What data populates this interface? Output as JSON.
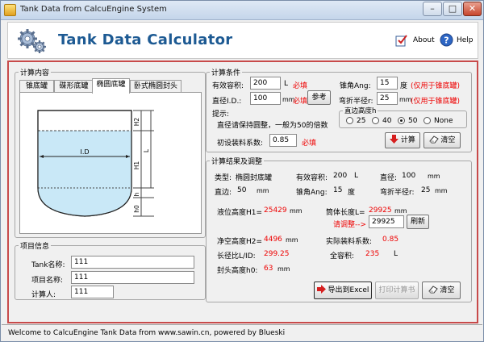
{
  "window": {
    "title": "Tank Data from CalcuEngine System"
  },
  "header": {
    "app_title": "Tank Data Calculator",
    "about": "About",
    "help": "Help"
  },
  "left": {
    "section_title": "计算内容",
    "tabs": [
      "锥底罐",
      "碟形底罐",
      "椭圆底罐",
      "卧式椭圆封头"
    ],
    "selected_tab": 2,
    "diagram": {
      "dim_labels": [
        "H2",
        "L",
        "H1",
        "I.D",
        "h",
        "h0"
      ]
    },
    "info": {
      "title": "项目信息",
      "tank_name_label": "Tank名称:",
      "tank_name": "111",
      "project_name_label": "项目名称:",
      "project_name": "111",
      "calc_person_label": "计算人:",
      "calc_person": "111"
    }
  },
  "conditions": {
    "title": "计算条件",
    "volume_label": "有效容积:",
    "volume": "200",
    "volume_unit": "L",
    "required": "必填",
    "id_label": "直径I.D.:",
    "id": "100",
    "id_unit": "mm",
    "ref_button": "参考",
    "tip_label": "提示:",
    "tip_text": "直径请保持圆整，一般为50的倍数",
    "fill_label": "初设装料系数:",
    "fill": "0.85",
    "cone_label": "锥角Ang:",
    "cone": "15",
    "cone_unit": "度",
    "cone_note": "(仅用于锥底罐)",
    "bend_label": "弯折半径r:",
    "bend": "25",
    "bend_unit": "mm",
    "bend_note": "(仅用于锥底罐)",
    "straight_title": "直边高度h",
    "straight_options": [
      "25",
      "40",
      "50",
      "None"
    ],
    "straight_selected": 2,
    "calc_button": "计算",
    "clear_button": "清空"
  },
  "results": {
    "title": "计算结果及调整",
    "type_label": "类型:",
    "type": "椭圆封底罐",
    "vol_label": "有效容积:",
    "vol": "200",
    "vol_unit": "L",
    "dia_label": "直径:",
    "dia": "100",
    "dia_unit": "mm",
    "h_label": "直边:",
    "h": "50",
    "h_unit": "mm",
    "ang_label": "锥角Ang:",
    "ang": "15",
    "ang_unit": "度",
    "r_label": "弯折半径r:",
    "r": "25",
    "r_unit": "mm",
    "h1_label": "液位高度H1=",
    "h1": "25429",
    "h1_unit": "mm",
    "l_label": "筒体长度L=",
    "l": "29925",
    "l_unit": "mm",
    "adjust_label": "请调整-->",
    "adjust": "29925",
    "refresh_button": "刷新",
    "h2_label": "净空高度H2=",
    "h2": "4496",
    "h2_unit": "mm",
    "actual_fill_label": "实际装料系数:",
    "actual_fill": "0.85",
    "ratio_label": "长径比L/ID:",
    "ratio": "299.25",
    "total_label": "全容积:",
    "total": "235",
    "total_unit": "L",
    "head_label": "封头高度h0:",
    "head": "63",
    "head_unit": "mm",
    "export_button": "导出到Excel",
    "print_button": "打印计算书",
    "clear_button": "清空"
  },
  "status": {
    "text": "Welcome to CalcuEngine Tank Data from www.sawin.cn, powered by Blueski"
  },
  "colors": {
    "accent": "#1d5a93",
    "border_red": "#c84a4a",
    "required": "#ee0000",
    "liquid": "#c9e8f7"
  }
}
